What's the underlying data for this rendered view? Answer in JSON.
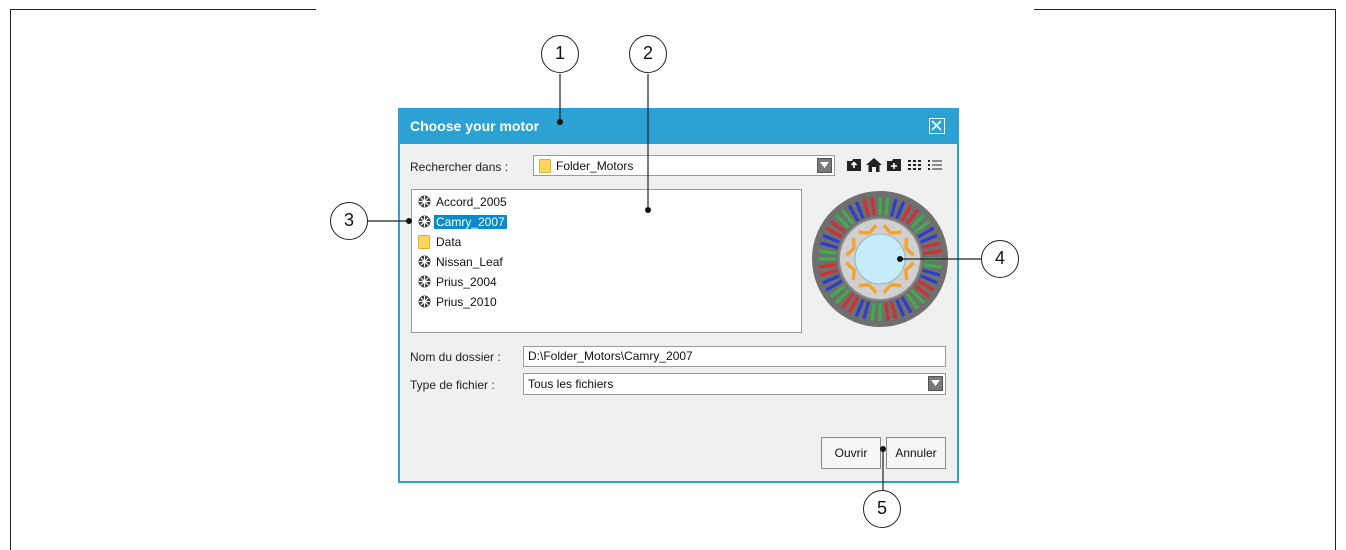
{
  "dialog": {
    "title": "Choose your motor",
    "look_in_label": "Rechercher dans :",
    "look_in_value": "Folder_Motors",
    "toolbar_icons": [
      "up-folder-icon",
      "home-icon",
      "new-folder-icon",
      "list-view-icon",
      "details-view-icon"
    ],
    "files": [
      {
        "name": "Accord_2005",
        "icon": "motor-icon",
        "selected": false
      },
      {
        "name": "Camry_2007",
        "icon": "motor-icon",
        "selected": true
      },
      {
        "name": "Data",
        "icon": "folder-icon",
        "selected": false
      },
      {
        "name": "Nissan_Leaf",
        "icon": "motor-icon",
        "selected": false
      },
      {
        "name": "Prius_2004",
        "icon": "motor-icon",
        "selected": false
      },
      {
        "name": "Prius_2010",
        "icon": "motor-icon",
        "selected": false
      }
    ],
    "folder_name_label": "Nom du dossier :",
    "folder_name_value": "D:\\Folder_Motors\\Camry_2007",
    "file_type_label": "Type de fichier :",
    "file_type_value": "Tous les fichiers",
    "open_button": "Ouvrir",
    "cancel_button": "Annuler",
    "accent_color": "#2ba1d4"
  },
  "callouts": {
    "c1": "1",
    "c2": "2",
    "c3": "3",
    "c4": "4",
    "c5": "5"
  }
}
